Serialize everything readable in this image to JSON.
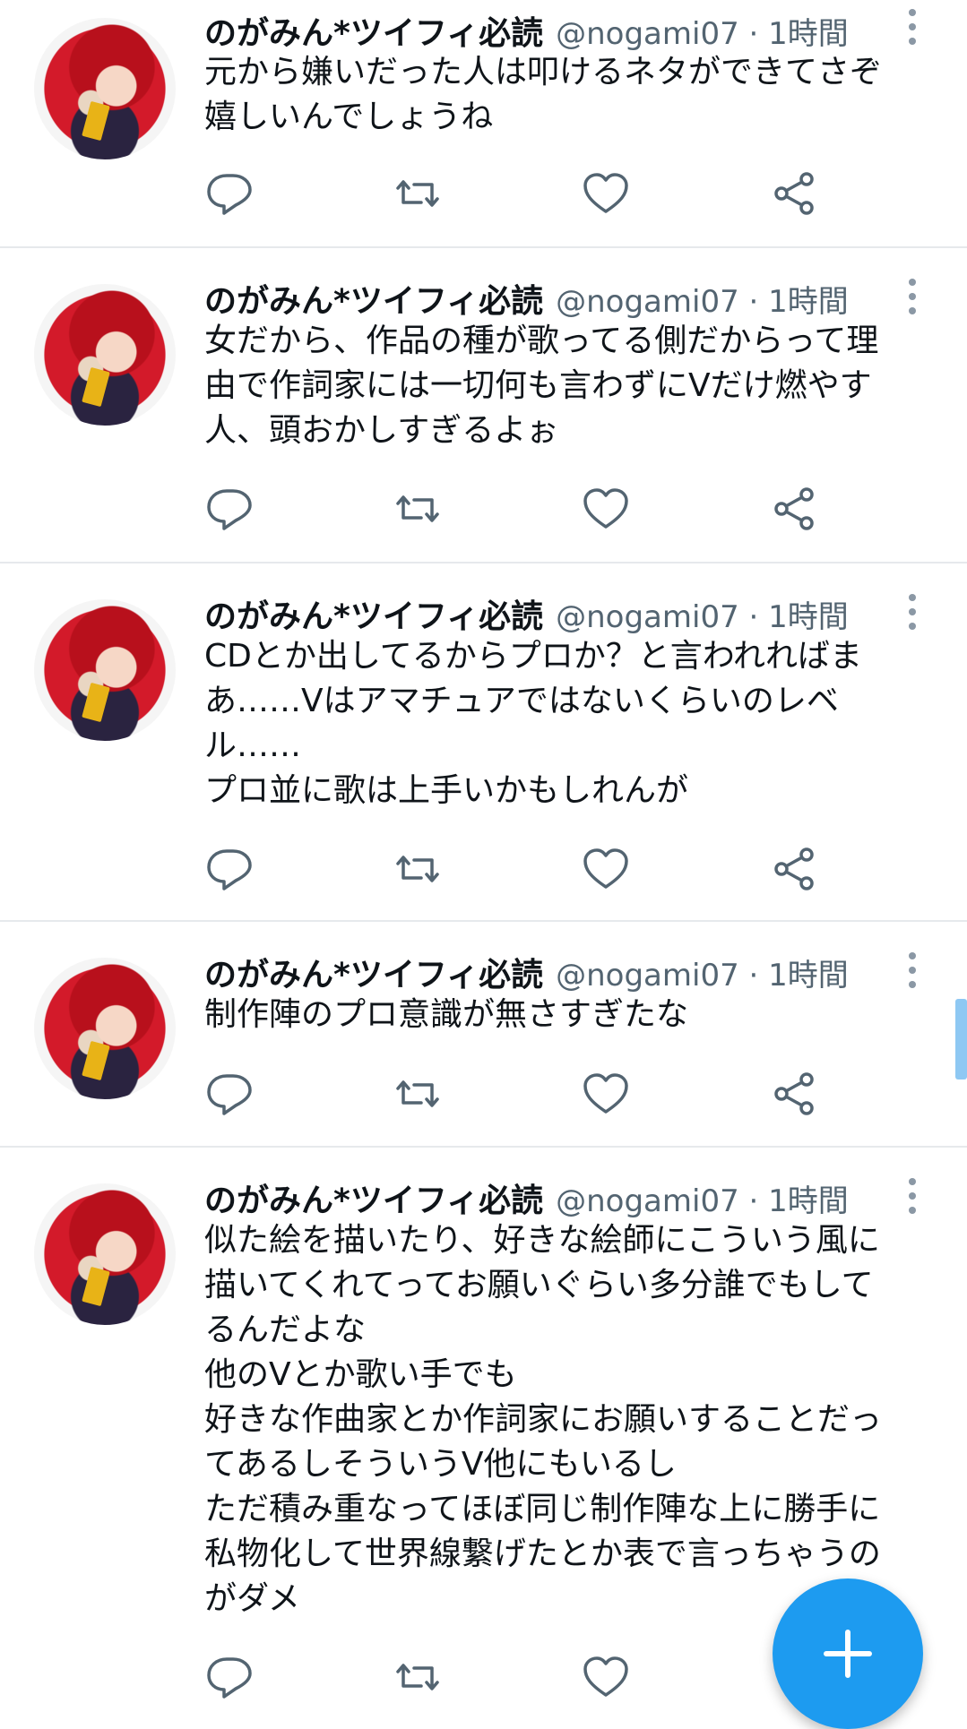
{
  "tweets": [
    {
      "name": "のがみん*ツイフィ必読",
      "handle": "@nogami07 · 1時間",
      "text": "元から嫌いだった人は叩けるネタができてさぞ\n嬉しいんでしょうね"
    },
    {
      "name": "のがみん*ツイフィ必読",
      "handle": "@nogami07 · 1時間",
      "text": "女だから、作品の種が歌ってる側だからって理\n由で作詞家には一切何も言わずにVだけ燃やす\n人、頭おかしすぎるよぉ"
    },
    {
      "name": "のがみん*ツイフィ必読",
      "handle": "@nogami07 · 1時間",
      "text": "CDとか出してるからプロか？と言われればま\nあ……Vはアマチュアではないくらいのレベ\nル……\nプロ並に歌は上手いかもしれんが"
    },
    {
      "name": "のがみん*ツイフィ必読",
      "handle": "@nogami07 · 1時間",
      "text": "制作陣のプロ意識が無さすぎたな"
    },
    {
      "name": "のがみん*ツイフィ必読",
      "handle": "@nogami07 · 1時間",
      "text": "似た絵を描いたり、好きな絵師にこういう風に\n描いてくれてってお願いぐらい多分誰でもして\nるんだよな\n他のVとか歌い手でも\n好きな作曲家とか作詞家にお願いすることだっ\nてあるしそういうV他にもいるし\nただ積み重なってほぼ同じ制作陣な上に勝手に\n私物化して世界線繋げたとか表で言っちゃうの\nがダメ"
    }
  ],
  "icons": {
    "reply": "reply-icon",
    "retweet": "retweet-icon",
    "like": "heart-icon",
    "share": "share-icon",
    "more": "more-vertical-icon",
    "compose": "plus-icon"
  },
  "colors": {
    "accent": "#1d9bf0",
    "icon": "#536471",
    "text": "#0f1419"
  }
}
